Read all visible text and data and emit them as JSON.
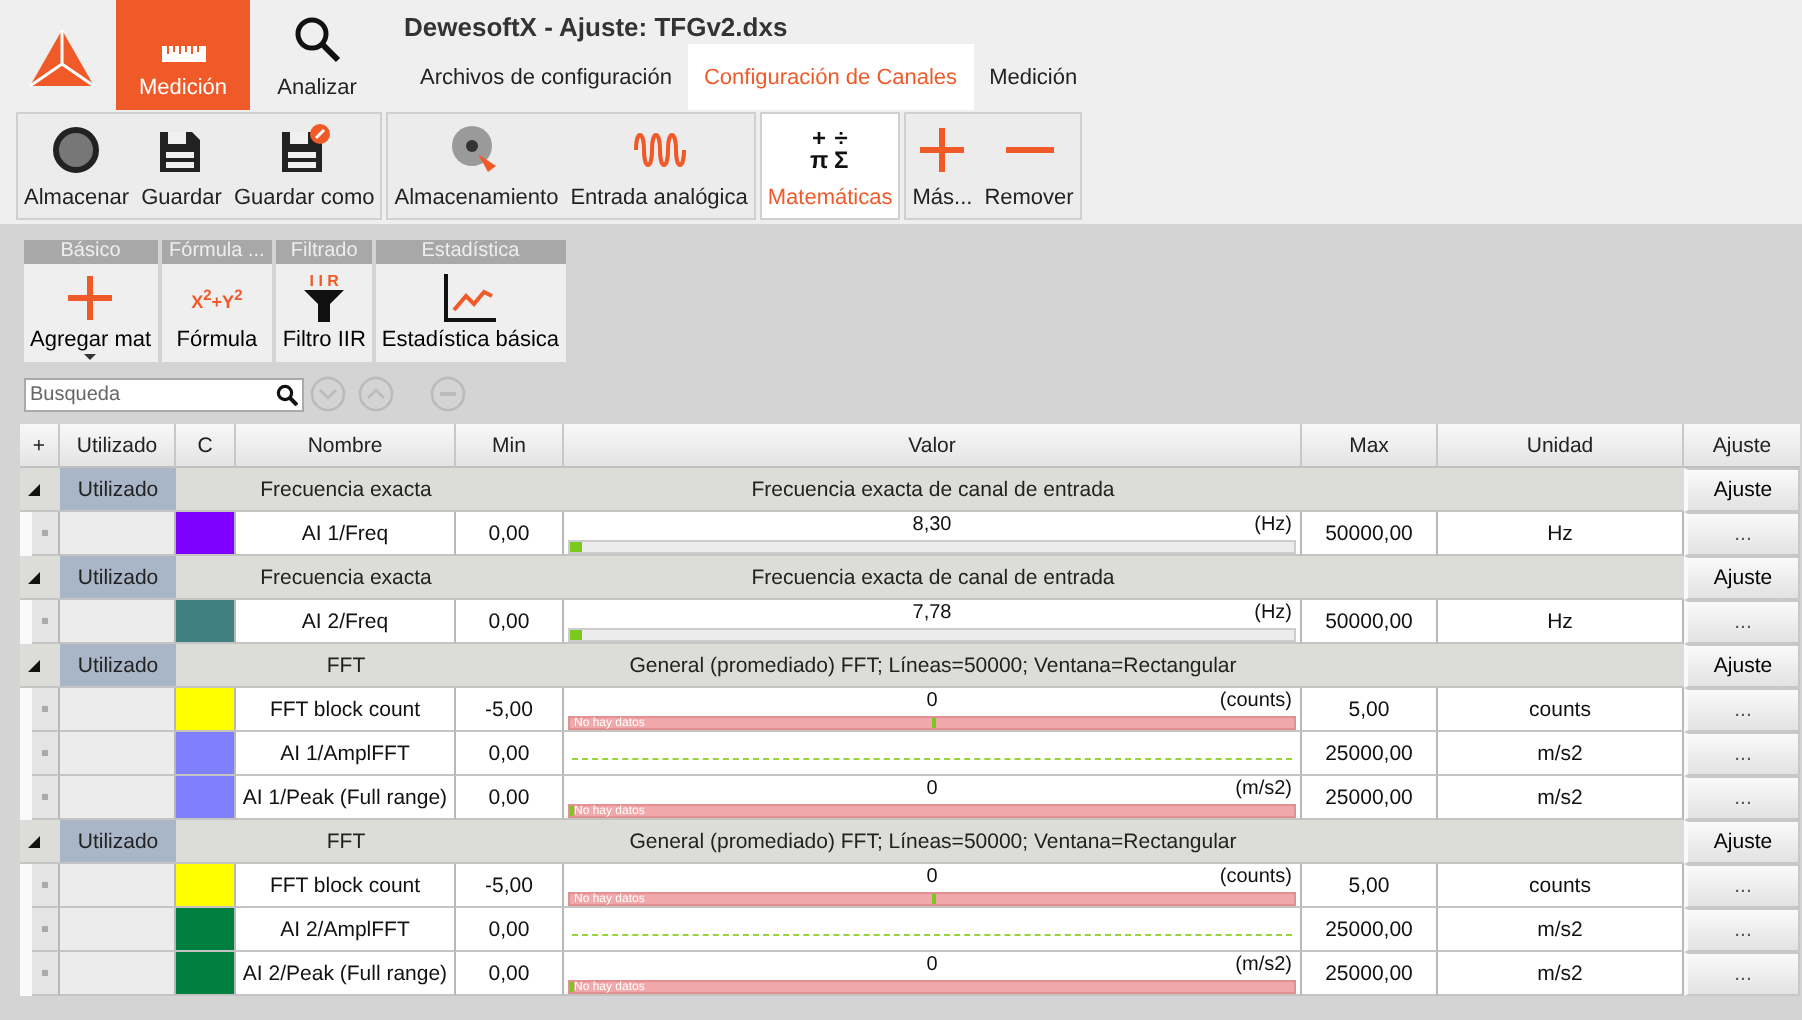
{
  "window": {
    "title": "DewesoftX - Ajuste: TFGv2.dxs"
  },
  "modes": [
    {
      "label": "Medición",
      "kind": "ruler",
      "selected": true
    },
    {
      "label": "Analizar",
      "kind": "search",
      "selected": false
    }
  ],
  "tabs": [
    {
      "label": "Archivos de configuración",
      "selected": false
    },
    {
      "label": "Configuración de Canales",
      "selected": true
    },
    {
      "label": "Medición",
      "selected": false
    }
  ],
  "toolbar_groups": [
    [
      {
        "label": "Almacenar",
        "kind": "record",
        "selected": false
      },
      {
        "label": "Guardar",
        "kind": "save",
        "selected": false
      },
      {
        "label": "Guardar como",
        "kind": "saveas",
        "selected": false
      }
    ],
    [
      {
        "label": "Almacenamiento",
        "kind": "disc",
        "selected": false
      },
      {
        "label": "Entrada analógica",
        "kind": "wave",
        "selected": false
      }
    ],
    [
      {
        "label": "Matemáticas",
        "kind": "math",
        "symbols": [
          "+",
          "÷",
          "π",
          "Σ"
        ],
        "selected": true
      }
    ],
    [
      {
        "label": "Más...",
        "kind": "plus",
        "selected": false
      },
      {
        "label": "Remover",
        "kind": "minus",
        "selected": false
      }
    ]
  ],
  "math_palette": [
    {
      "title": "Básico",
      "item": {
        "label": "Agregar mat",
        "kind": "plus",
        "dropdown": true
      }
    },
    {
      "title": "Fórmula ...",
      "item": {
        "label": "Fórmula",
        "kind": "formula",
        "formula": "X$^{2}$+Y$^{2}$"
      }
    },
    {
      "title": "Filtrado",
      "item": {
        "label": "Filtro IIR",
        "kind": "filter",
        "tag": "I I R"
      }
    },
    {
      "title": "Estadística",
      "item": {
        "label": "Estadística básica",
        "kind": "chart"
      }
    }
  ],
  "search": {
    "placeholder": "Busqueda"
  },
  "table": {
    "columns": [
      "+",
      "Utilizado",
      "C",
      "Nombre",
      "Min",
      "Valor",
      "Max",
      "Unidad",
      "Ajuste"
    ],
    "groups": [
      {
        "expanded": true,
        "used": "Utilizado",
        "name": "Frecuencia exacta",
        "description": "Frecuencia exacta de canal de entrada",
        "button": "Ajuste",
        "rows": [
          {
            "color": "#8000ff",
            "name": "AI 1/Freq",
            "min": "0,00",
            "kind": "meter",
            "value": "8,30",
            "unit_tag": "(Hz)",
            "level": 0.01,
            "max": "50000,00",
            "unit": "Hz",
            "button": "..."
          }
        ]
      },
      {
        "expanded": true,
        "used": "Utilizado",
        "name": "Frecuencia exacta",
        "description": "Frecuencia exacta de canal de entrada",
        "button": "Ajuste",
        "rows": [
          {
            "color": "#408080",
            "name": "AI 2/Freq",
            "min": "0,00",
            "kind": "meter",
            "value": "7,78",
            "unit_tag": "(Hz)",
            "level": 0.01,
            "max": "50000,00",
            "unit": "Hz",
            "button": "..."
          }
        ]
      },
      {
        "expanded": true,
        "used": "Utilizado",
        "name": "FFT",
        "description": "General (promediado) FFT; Líneas=50000; Ventana=Rectangular",
        "button": "Ajuste",
        "rows": [
          {
            "color": "#ffff00",
            "name": "FFT block count",
            "min": "-5,00",
            "kind": "nodata",
            "value": "0",
            "unit_tag": "(counts)",
            "status": "No hay datos",
            "level": 0.5,
            "max": "5,00",
            "unit": "counts",
            "button": "..."
          },
          {
            "color": "#8080ff",
            "name": "AI 1/AmplFFT",
            "min": "0,00",
            "kind": "dashed",
            "max": "25000,00",
            "unit": "m/s2",
            "button": "..."
          },
          {
            "color": "#8080ff",
            "name": "AI 1/Peak (Full range)",
            "min": "0,00",
            "kind": "nodata",
            "value": "0",
            "unit_tag": "(m/s2)",
            "status": "No hay datos",
            "level": 0,
            "max": "25000,00",
            "unit": "m/s2",
            "button": "..."
          }
        ]
      },
      {
        "expanded": true,
        "used": "Utilizado",
        "name": "FFT",
        "description": "General (promediado) FFT; Líneas=50000; Ventana=Rectangular",
        "button": "Ajuste",
        "rows": [
          {
            "color": "#ffff00",
            "name": "FFT block count",
            "min": "-5,00",
            "kind": "nodata",
            "value": "0",
            "unit_tag": "(counts)",
            "status": "No hay datos",
            "level": 0.5,
            "max": "5,00",
            "unit": "counts",
            "button": "..."
          },
          {
            "color": "#008040",
            "name": "AI 2/AmplFFT",
            "min": "0,00",
            "kind": "dashed",
            "max": "25000,00",
            "unit": "m/s2",
            "button": "..."
          },
          {
            "color": "#008040",
            "name": "AI 2/Peak (Full range)",
            "min": "0,00",
            "kind": "nodata",
            "value": "0",
            "unit_tag": "(m/s2)",
            "status": "No hay datos",
            "level": 0,
            "max": "25000,00",
            "unit": "m/s2",
            "button": "..."
          }
        ]
      }
    ]
  }
}
